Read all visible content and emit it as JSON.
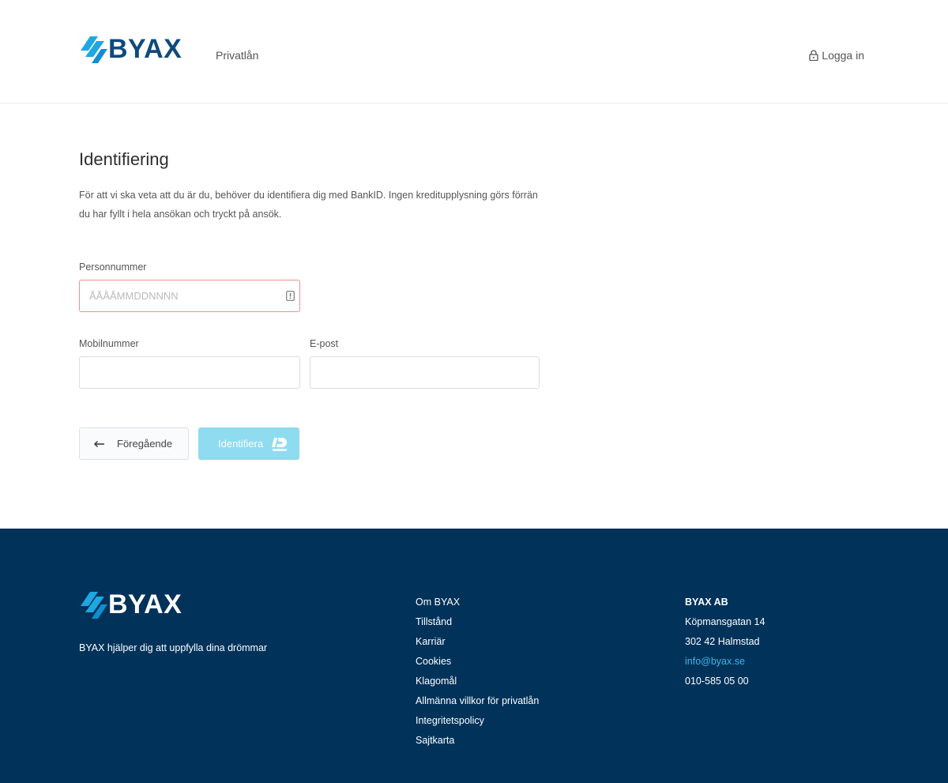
{
  "header": {
    "logo_text": "BYAX",
    "nav_link": "Privatlån",
    "login_label": "Logga in"
  },
  "main": {
    "title": "Identifiering",
    "intro": "För att vi ska veta att du är du, behöver du identifiera dig med BankID. Ingen kreditupplysning görs förrän du har fyllt i hela ansökan och tryckt på ansök.",
    "personnummer_label": "Personnummer",
    "personnummer_placeholder": "ÅÅÅÅMMDDNNNN",
    "personnummer_value": "",
    "mobil_label": "Mobilnummer",
    "mobil_value": "",
    "email_label": "E-post",
    "email_value": "",
    "prev_button": "Föregående",
    "identify_button": "Identifiera"
  },
  "footer": {
    "logo_text": "BYAX",
    "tagline": "BYAX hjälper dig att uppfylla dina drömmar",
    "links": [
      "Om BYAX",
      "Tillstånd",
      "Karriär",
      "Cookies",
      "Klagomål",
      "Allmänna villkor för privatlån",
      "Integritetspolicy",
      "Sajtkarta"
    ],
    "contact": {
      "company": "BYAX AB",
      "street": "Köpmansgatan 14",
      "city": "302 42 Halmstad",
      "email": "info@byax.se",
      "phone": "010-585 05 00"
    }
  },
  "colors": {
    "brand_dark": "#0f4a7e",
    "brand_accent": "#1ea7e1",
    "footer_bg": "#00325a",
    "button_disabled": "#8fdbf0",
    "error_border": "#e8938f",
    "link_blue": "#3fb6e8"
  },
  "icons": {
    "logo_mark": "byax-stripes-icon",
    "login": "lock-icon",
    "field_error": "alert-icon",
    "prev": "arrow-left-icon",
    "identify": "bankid-icon"
  }
}
